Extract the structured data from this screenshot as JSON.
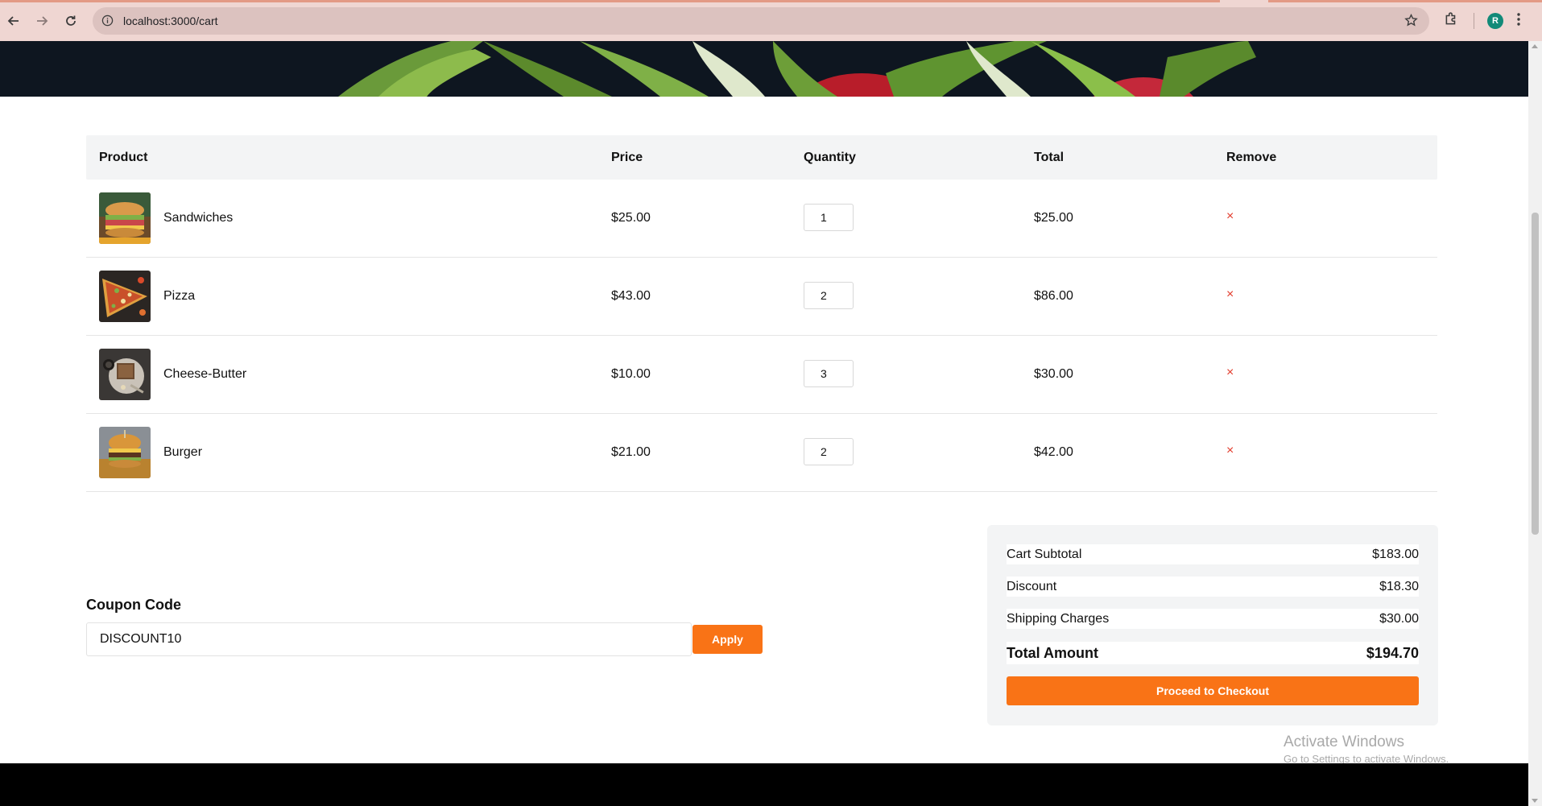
{
  "browser": {
    "url": "localhost:3000/cart",
    "profile_initial": "R"
  },
  "table": {
    "headers": {
      "product": "Product",
      "price": "Price",
      "quantity": "Quantity",
      "total": "Total",
      "remove": "Remove"
    },
    "items": [
      {
        "name": "Sandwiches",
        "price": "$25.00",
        "quantity": "1",
        "total": "$25.00",
        "remove": "×"
      },
      {
        "name": "Pizza",
        "price": "$43.00",
        "quantity": "2",
        "total": "$86.00",
        "remove": "×"
      },
      {
        "name": "Cheese-Butter",
        "price": "$10.00",
        "quantity": "3",
        "total": "$30.00",
        "remove": "×"
      },
      {
        "name": "Burger",
        "price": "$21.00",
        "quantity": "2",
        "total": "$42.00",
        "remove": "×"
      }
    ]
  },
  "coupon": {
    "title": "Coupon Code",
    "value": "DISCOUNT10",
    "apply_label": "Apply"
  },
  "summary": {
    "subtotal_label": "Cart Subtotal",
    "subtotal_value": "$183.00",
    "discount_label": "Discount",
    "discount_value": "$18.30",
    "shipping_label": "Shipping Charges",
    "shipping_value": "$30.00",
    "total_label": "Total Amount",
    "total_value": "$194.70",
    "checkout_label": "Proceed to Checkout"
  },
  "watermark": {
    "line1": "Activate Windows",
    "line2": "Go to Settings to activate Windows."
  },
  "colors": {
    "accent": "#f97316",
    "remove": "#e23a2a",
    "header_bg": "#f3f4f5"
  }
}
